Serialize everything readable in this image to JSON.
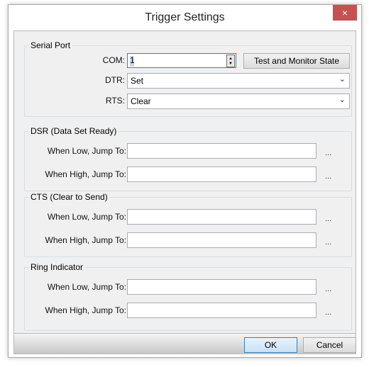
{
  "window": {
    "title": "Trigger Settings",
    "close_glyph": "×"
  },
  "serial_port": {
    "legend": "Serial Port",
    "com_label": "COM:",
    "com_value": "1",
    "test_button": "Test and Monitor State",
    "dtr_label": "DTR:",
    "dtr_value": "Set",
    "rts_label": "RTS:",
    "rts_value": "Clear"
  },
  "dsr": {
    "legend": "DSR (Data Set Ready)",
    "low_label": "When Low, Jump To:",
    "low_value": "",
    "high_label": "When High, Jump To:",
    "high_value": ""
  },
  "cts": {
    "legend": "CTS (Clear to Send)",
    "low_label": "When Low, Jump To:",
    "low_value": "",
    "high_label": "When High, Jump To:",
    "high_value": ""
  },
  "ring": {
    "legend": "Ring Indicator",
    "low_label": "When Low, Jump To:",
    "low_value": "",
    "high_label": "When High, Jump To:",
    "high_value": ""
  },
  "browse": "...",
  "buttons": {
    "ok": "OK",
    "cancel": "Cancel"
  }
}
